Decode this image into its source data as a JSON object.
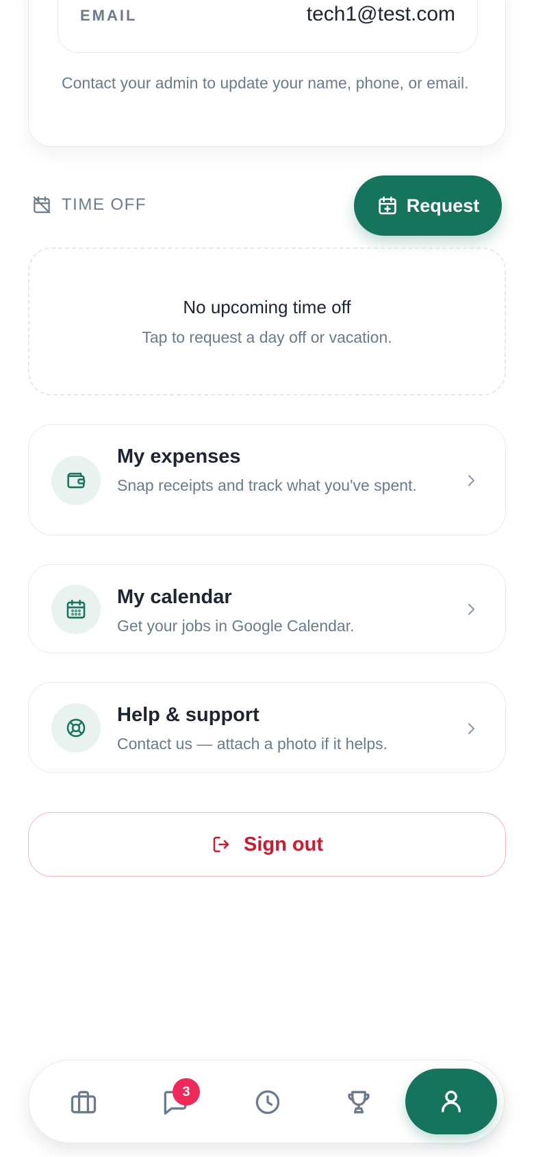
{
  "account": {
    "email_label": "EMAIL",
    "email_value": "tech1@test.com",
    "note": "Contact your admin to update your name, phone, or email."
  },
  "time_off": {
    "title": "TIME OFF",
    "request_label": "Request",
    "empty_title": "No upcoming time off",
    "empty_subtitle": "Tap to request a day off or vacation."
  },
  "menu": [
    {
      "icon": "wallet-icon",
      "title": "My expenses",
      "subtitle": "Snap receipts and track what you've spent."
    },
    {
      "icon": "calendar-icon",
      "title": "My calendar",
      "subtitle": "Get your jobs in Google Calendar."
    },
    {
      "icon": "lifebuoy-icon",
      "title": "Help & support",
      "subtitle": "Contact us — attach a photo if it helps."
    }
  ],
  "sign_out": {
    "label": "Sign out"
  },
  "bottom_nav": {
    "items": [
      "briefcase-icon",
      "chat-icon",
      "clock-icon",
      "trophy-icon",
      "user-icon"
    ],
    "active": "user-icon",
    "chat_badge": "3"
  },
  "colors": {
    "accent": "#15755c",
    "accent_soft": "#e8f3ef",
    "danger": "#cc1a2e",
    "badge": "#f0295a",
    "muted_text": "#6b7a8d"
  }
}
